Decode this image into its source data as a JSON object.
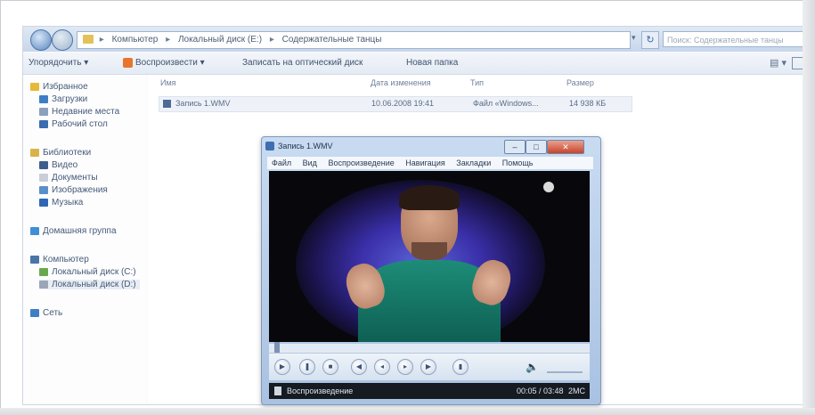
{
  "explorer": {
    "breadcrumbs": [
      "Компьютер",
      "Локальный диск (E:)",
      "Содержательные танцы"
    ],
    "search_placeholder": "Поиск: Содержательные танцы",
    "toolbar": [
      "Упорядочить ▾",
      "Воспроизвести ▾",
      "Записать на оптический диск",
      "Новая папка"
    ],
    "columns": [
      "Имя",
      "Дата изменения",
      "Тип",
      "Размер"
    ],
    "file": {
      "name": "Запись 1.WMV",
      "date": "10.06.2008 19:41",
      "type": "Файл «Windows...",
      "size": "14 938 КБ"
    },
    "sidebar": [
      {
        "label": "Избранное",
        "color": "#e8b838"
      },
      {
        "label": "Загрузки",
        "color": "#3f7ec4"
      },
      {
        "label": "Недавние места",
        "color": "#8aa0bd"
      },
      {
        "label": "Рабочий стол",
        "color": "#3b6bb0"
      },
      {
        "label": "Библиотеки",
        "color": "#d9b34a"
      },
      {
        "label": "Видео",
        "color": "#3e5f8c"
      },
      {
        "label": "Документы",
        "color": "#c8cfd9"
      },
      {
        "label": "Изображения",
        "color": "#5b8fc7"
      },
      {
        "label": "Музыка",
        "color": "#2f66b3"
      },
      {
        "label": "Домашняя группа",
        "color": "#3f8fd6"
      },
      {
        "label": "Компьютер",
        "color": "#4a74a8"
      },
      {
        "label": "Локальный диск (C:)",
        "color": "#6aa84f"
      },
      {
        "label": "Локальный диск (D:)",
        "color": "#9aa6b5"
      },
      {
        "label": "Сеть",
        "color": "#3f7ec4"
      }
    ]
  },
  "player": {
    "title": "Запись 1.WMV",
    "menu": [
      "Файл",
      "Вид",
      "Воспроизведение",
      "Навигация",
      "Закладки",
      "Помощь"
    ],
    "status": "Воспроизведение",
    "time": "00:05 / 03:48",
    "ext": "2MC"
  }
}
